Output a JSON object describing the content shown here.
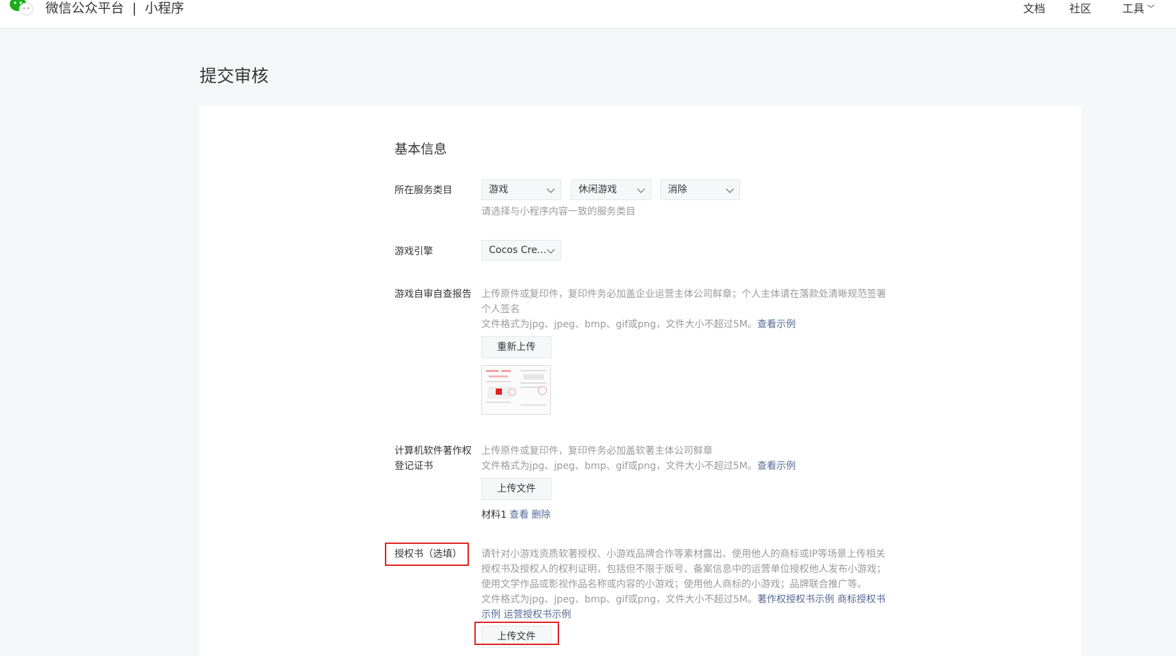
{
  "header": {
    "brand": "微信公众平台",
    "separator": "|",
    "product": "小程序",
    "nav": {
      "docs": "文档",
      "community": "社区",
      "tools": "工具"
    }
  },
  "page_title": "提交审核",
  "basic_info": {
    "title": "基本信息",
    "service_category": {
      "label": "所在服务类目",
      "selects": [
        "游戏",
        "休闲游戏",
        "消除"
      ],
      "tip": "请选择与小程序内容一致的服务类目"
    },
    "game_engine": {
      "label": "游戏引擎",
      "value": "Cocos Cre..."
    },
    "self_check_report": {
      "label": "游戏自审自查报告",
      "tip_line1": "上传原件或复印件，复印件务必加盖企业运营主体公司鲜章；个人主体请在落款处清晰规范签署",
      "tip_line2": "个人签名",
      "format_tip": "文件格式为jpg、jpeg、bmp、gif或png，文件大小不超过5M。",
      "example_link": "查看示例",
      "reupload_button": "重新上传"
    },
    "software_copyright": {
      "label_line1": "计算机软件著作权",
      "label_line2": "登记证书",
      "tip": "上传原件或复印件，复印件务必加盖软著主体公司鲜章",
      "format_tip": "文件格式为jpg、jpeg、bmp、gif或png，文件大小不超过5M。",
      "example_link": "查看示例",
      "upload_button": "上传文件",
      "material_label": "材料1",
      "view_link": "查看",
      "delete_link": "删除"
    },
    "authorization": {
      "label": "授权书（选填）",
      "tip_line1": "请针对小游戏资质软著授权、小游戏品牌合作等素材露出、使用他人的商标或IP等场景上传相关",
      "tip_line2": "授权书及授权人的权利证明，包括但不限于版号、备案信息中的运营单位授权他人发布小游戏；",
      "tip_line3": "使用文学作品或影视作品名称或内容的小游戏；使用他人商标的小游戏；品牌联合推广等。",
      "format_tip": "文件格式为jpg、jpeg、bmp、gif或png，文件大小不超过5M。",
      "link_copyright": "著作权授权书示例",
      "link_trademark_a": "商标授权书",
      "link_trademark_b": "示例",
      "link_operation": "运营授权书示例",
      "upload_button": "上传文件"
    }
  },
  "colors": {
    "link": "#576b95",
    "highlight": "#e02020",
    "tip": "#9a9a9a"
  }
}
